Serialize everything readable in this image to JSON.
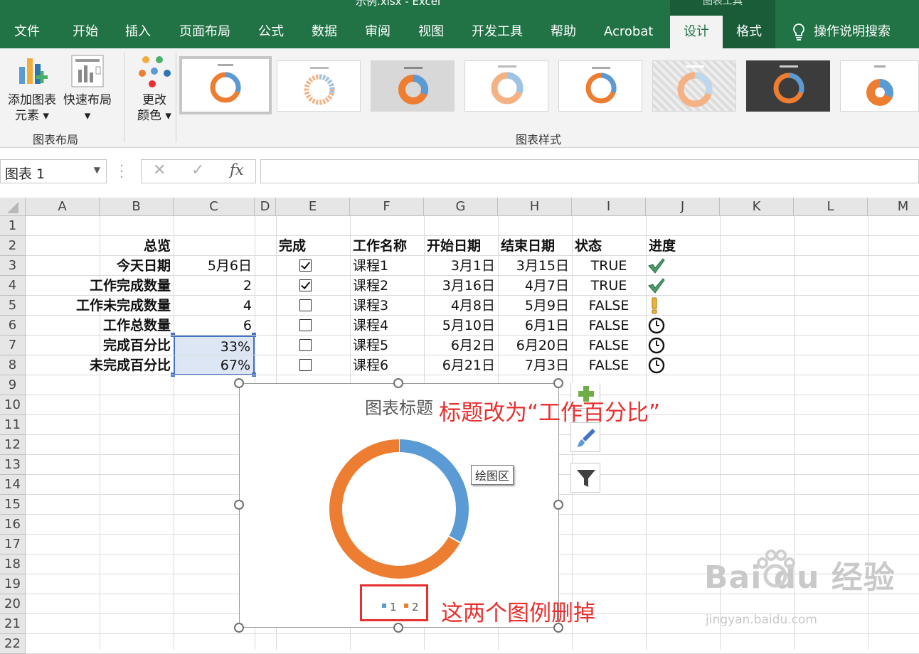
{
  "titlebar": {
    "filename": "示例.xlsx - Excel",
    "context_title": "图表工具"
  },
  "tabs": [
    "文件",
    "开始",
    "插入",
    "页面布局",
    "公式",
    "数据",
    "审阅",
    "视图",
    "开发工具",
    "帮助",
    "Acrobat",
    "设计",
    "格式"
  ],
  "search": {
    "label": "操作说明搜索"
  },
  "ribbon": {
    "add_element": [
      "添加图表",
      "元素 ▾"
    ],
    "quick_layout": [
      "快速布局",
      "▾"
    ],
    "change_colors": [
      "更改",
      "颜色 ▾"
    ],
    "group_layout": "图表布局",
    "group_styles": "图表样式"
  },
  "formula": {
    "namebox": "图表 1",
    "cancel": "✕",
    "enter": "✓",
    "fx": "fx",
    "value": ""
  },
  "columns": [
    "A",
    "B",
    "C",
    "D",
    "E",
    "F",
    "G",
    "H",
    "I",
    "J",
    "K",
    "L",
    "M"
  ],
  "rows": [
    "1",
    "2",
    "3",
    "4",
    "5",
    "6",
    "7",
    "8",
    "9",
    "10",
    "11",
    "12",
    "13",
    "14",
    "15",
    "16",
    "17",
    "18",
    "19",
    "20",
    "21",
    "22"
  ],
  "summary": {
    "header": "总览",
    "labels": [
      "今天日期",
      "工作完成数量",
      "工作未完成数量",
      "工作总数量",
      "完成百分比",
      "未完成百分比"
    ],
    "values": [
      "5月6日",
      "2",
      "4",
      "6",
      "33%",
      "67%"
    ]
  },
  "table": {
    "headers": [
      "完成",
      "工作名称",
      "开始日期",
      "结束日期",
      "状态",
      "进度"
    ],
    "rows": [
      {
        "done": true,
        "name": "课程1",
        "start": "3月1日",
        "end": "3月15日",
        "status": "TRUE",
        "progress": "check"
      },
      {
        "done": true,
        "name": "课程2",
        "start": "3月16日",
        "end": "4月7日",
        "status": "TRUE",
        "progress": "check"
      },
      {
        "done": false,
        "name": "课程3",
        "start": "4月8日",
        "end": "5月9日",
        "status": "FALSE",
        "progress": "exclamation"
      },
      {
        "done": false,
        "name": "课程4",
        "start": "5月10日",
        "end": "6月1日",
        "status": "FALSE",
        "progress": "clock"
      },
      {
        "done": false,
        "name": "课程5",
        "start": "6月2日",
        "end": "6月20日",
        "status": "FALSE",
        "progress": "clock"
      },
      {
        "done": false,
        "name": "课程6",
        "start": "6月21日",
        "end": "7月3日",
        "status": "FALSE",
        "progress": "clock"
      }
    ]
  },
  "chart_data": {
    "type": "pie",
    "title": "图表标题",
    "categories": [
      "1",
      "2"
    ],
    "values": [
      33,
      67
    ],
    "colors": [
      "#5b9bd5",
      "#ed7d31"
    ],
    "legend": "bottom"
  },
  "chart_ui": {
    "plot_area_tooltip": "绘图区"
  },
  "annotations": {
    "title_note": "标题改为“工作百分比”",
    "legend_note": "这两个图例删掉"
  },
  "watermark": {
    "brand": "Bai du 经验",
    "url": "jingyan.baidu.com"
  },
  "colors": {
    "excel_green": "#217346",
    "accent_red": "#e8302f"
  }
}
